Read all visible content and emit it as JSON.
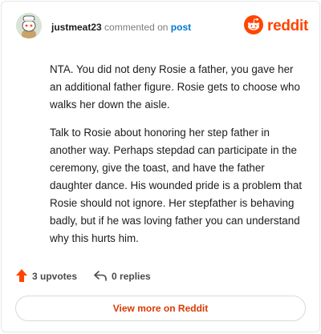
{
  "comment": {
    "username": "justmeat23",
    "action_text": "commented on",
    "target_link": "post",
    "paragraphs": [
      "NTA. You did not deny Rosie a father, you gave her an additional father figure. Rosie gets to choose who walks her down the aisle.",
      "Talk to Rosie about honoring her step father in another way. Perhaps stepdad can participate in the ceremony, give the toast, and have the father daughter dance. His wounded pride is a problem that Rosie should not ignore. Her stepfather is behaving badly, but if he was loving father you can understand why this hurts him."
    ]
  },
  "brand": {
    "wordmark": "reddit",
    "color": "#ff4500"
  },
  "footer": {
    "upvotes_label": "3 upvotes",
    "replies_label": "0 replies"
  },
  "cta": {
    "label": "View more on Reddit"
  },
  "icons": {
    "avatar": "snoo-avatar-icon",
    "brand": "reddit-logo-icon",
    "upvote": "upvote-arrow-icon",
    "reply": "reply-arrow-icon"
  }
}
